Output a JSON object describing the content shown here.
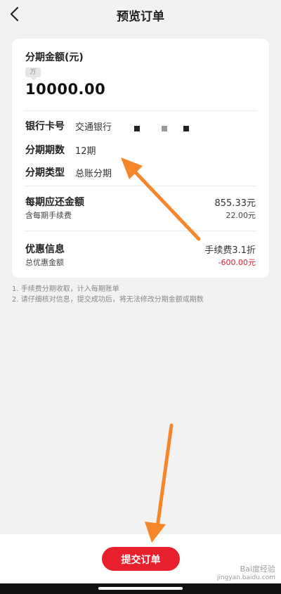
{
  "header": {
    "title": "预览订单"
  },
  "amount": {
    "label": "分期金额(元)",
    "unit_tag": "万",
    "value": "10000.00"
  },
  "details": [
    {
      "label": "银行卡号",
      "value": "交通银行"
    },
    {
      "label": "分期期数",
      "value": "12期"
    },
    {
      "label": "分期类型",
      "value": "总账分期"
    }
  ],
  "repayment": {
    "title": "每期应还金额",
    "amount": "855.33元",
    "fee_label": "含每期手续费",
    "fee_amount": "22.00元"
  },
  "discount": {
    "title": "优惠信息",
    "rate": "手续费3.1折",
    "total_label": "总优惠金额",
    "total_amount": "-600.00元"
  },
  "notes": [
    "1. 手续费分期收取，计入每期账单",
    "2. 请仔细核对信息，提交成功后，将无法修改分期金额或期数"
  ],
  "submit_label": "提交订单",
  "watermark": {
    "name": "Bai度经验",
    "url": "jingyan.baidu.com"
  },
  "colors": {
    "primary_red": "#e8202e",
    "arrow_orange": "#f5862a"
  }
}
